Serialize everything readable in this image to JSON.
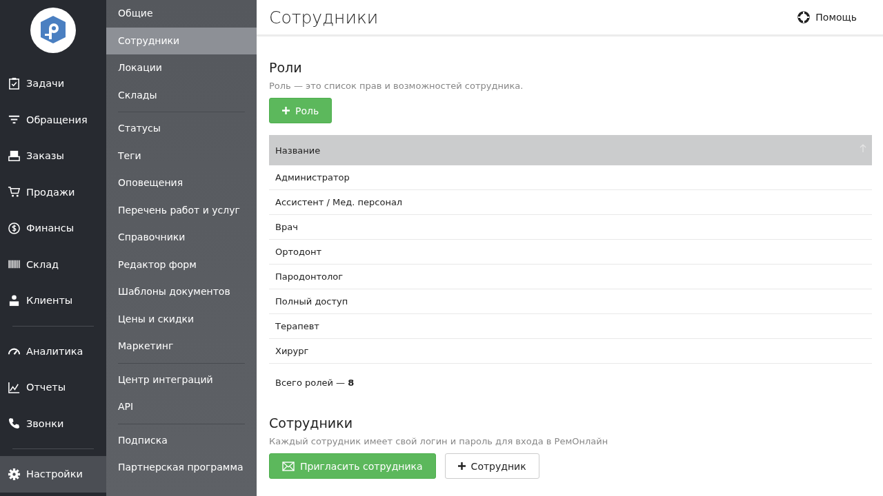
{
  "main_nav": {
    "groups": [
      [
        {
          "label": "Задачи",
          "selected": false
        },
        {
          "label": "Обращения",
          "selected": false
        },
        {
          "label": "Заказы",
          "selected": false
        },
        {
          "label": "Продажи",
          "selected": false
        },
        {
          "label": "Финансы",
          "selected": false
        },
        {
          "label": "Склад",
          "selected": false
        },
        {
          "label": "Клиенты",
          "selected": false
        }
      ],
      [
        {
          "label": "Аналитика",
          "selected": false
        },
        {
          "label": "Отчеты",
          "selected": false
        },
        {
          "label": "Звонки",
          "selected": false
        }
      ],
      [
        {
          "label": "Настройки",
          "selected": true
        }
      ]
    ]
  },
  "settings_nav": {
    "groups": [
      [
        {
          "label": "Общие",
          "selected": false
        },
        {
          "label": "Сотрудники",
          "selected": true
        },
        {
          "label": "Локации",
          "selected": false
        },
        {
          "label": "Склады",
          "selected": false
        }
      ],
      [
        {
          "label": "Статусы",
          "selected": false
        },
        {
          "label": "Теги",
          "selected": false
        },
        {
          "label": "Оповещения",
          "selected": false
        },
        {
          "label": "Перечень работ и услуг",
          "selected": false
        },
        {
          "label": "Справочники",
          "selected": false
        },
        {
          "label": "Редактор форм",
          "selected": false
        },
        {
          "label": "Шаблоны документов",
          "selected": false
        },
        {
          "label": "Цены и скидки",
          "selected": false
        },
        {
          "label": "Маркетинг",
          "selected": false
        }
      ],
      [
        {
          "label": "Центр интеграций",
          "selected": false
        },
        {
          "label": "API",
          "selected": false
        }
      ],
      [
        {
          "label": "Подписка",
          "selected": false
        },
        {
          "label": "Партнерская программа",
          "selected": false
        }
      ]
    ]
  },
  "header": {
    "title": "Сотрудники",
    "help": "Помощь"
  },
  "roles": {
    "title": "Роли",
    "description": "Роль — это список прав и возможностей сотрудника.",
    "add_button": "Роль",
    "table": {
      "columns": [
        "Название"
      ],
      "rows": [
        "Администратор",
        "Ассистент / Мед. персонал",
        "Врач",
        "Ортодонт",
        "Пародонтолог",
        "Полный доступ",
        "Терапевт",
        "Хирург"
      ]
    },
    "total": "Всего ролей — **8**"
  },
  "employees": {
    "title": "Сотрудники",
    "description": "Каждый сотрудник имеет свой логин и пароль для входа в РемОнлайн",
    "invite_button": "Пригласить сотрудника",
    "add_button": "Сотрудник"
  }
}
